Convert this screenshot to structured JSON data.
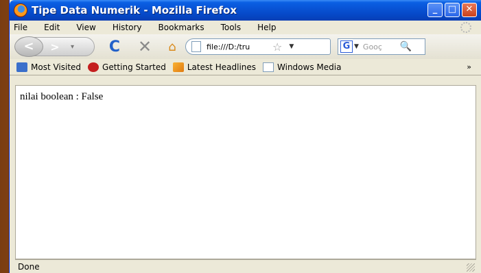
{
  "window": {
    "title": "Tipe Data Numerik - Mozilla Firefox",
    "minimize": "_",
    "maximize": "□",
    "close": "✕"
  },
  "menu": {
    "items": [
      "File",
      "Edit",
      "View",
      "History",
      "Bookmarks",
      "Tools",
      "Help"
    ]
  },
  "nav": {
    "back": "<",
    "forward": ">",
    "history_dropdown": "▾",
    "reload": "C",
    "stop": "✕",
    "home": "⌂",
    "url": "file:///D:/tru",
    "star": "☆",
    "url_dropdown": "▼",
    "search_engine_icon": "G",
    "search_dropdown": "▼",
    "search_placeholder": "Gooç",
    "search_icon": "🔍"
  },
  "bookmarks": {
    "items": [
      "Most Visited",
      "Getting Started",
      "Latest Headlines",
      "Windows Media"
    ],
    "more": "»"
  },
  "content": {
    "text": "nilai boolean : False"
  },
  "status": {
    "text": "Done"
  }
}
